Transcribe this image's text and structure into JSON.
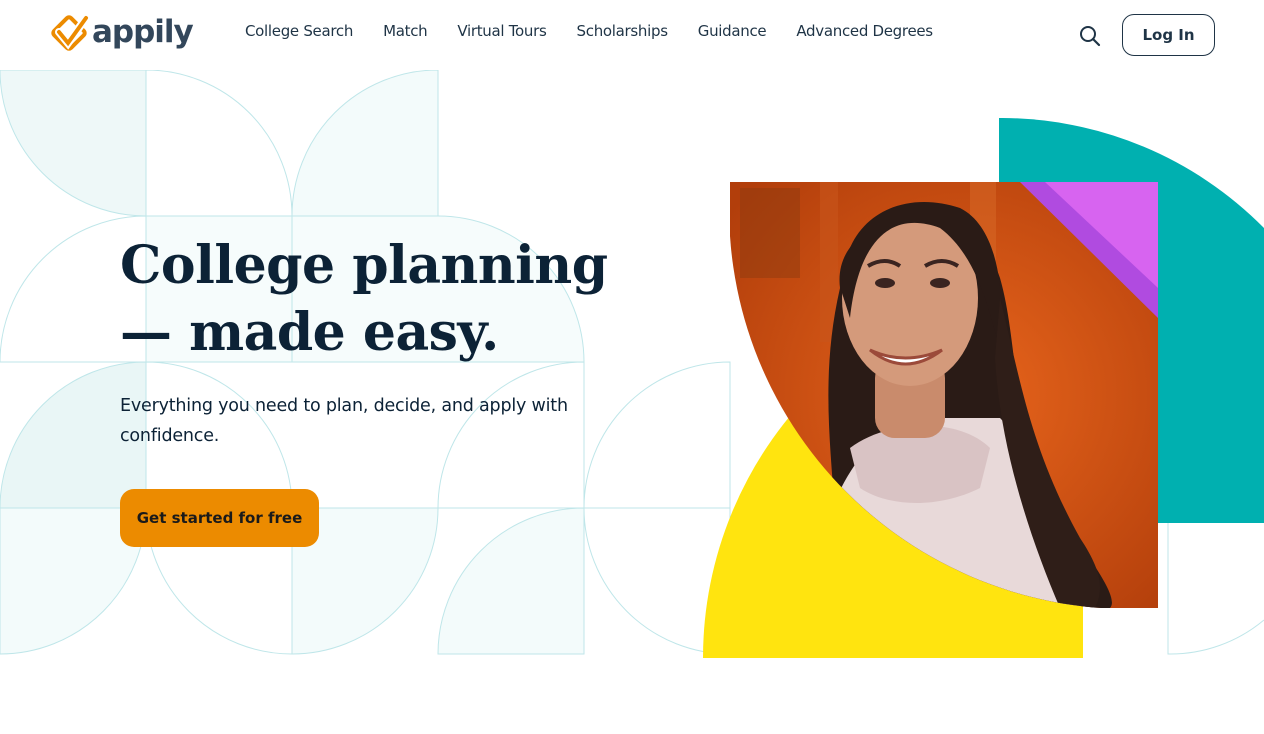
{
  "brand": {
    "name": "appily",
    "logo_icon": "check-mark-diamond-icon",
    "orange": "#ec8b00",
    "teal": "#00b0b0",
    "yellow": "#ffe40f",
    "navy": "#0c2236"
  },
  "nav": {
    "items": [
      {
        "label": "College Search"
      },
      {
        "label": "Match"
      },
      {
        "label": "Virtual Tours"
      },
      {
        "label": "Scholarships"
      },
      {
        "label": "Guidance"
      },
      {
        "label": "Advanced Degrees"
      }
    ],
    "search_icon": "search-icon",
    "login_label": "Log In"
  },
  "hero": {
    "title_line1": "College planning",
    "title_line2": "— made easy.",
    "subtitle": "Everything you need to plan, decide, and apply with confidence.",
    "cta_label": "Get started for free",
    "photo": "smiling-student-photo"
  }
}
